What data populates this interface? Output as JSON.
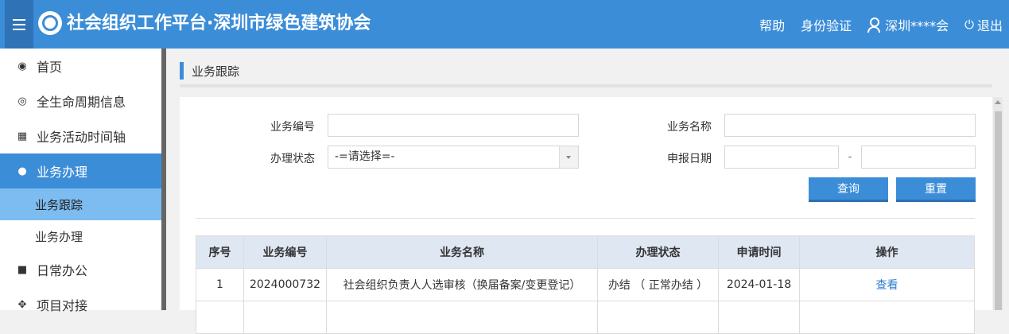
{
  "header": {
    "title": "社会组织工作平台·深圳市绿色建筑协会",
    "links": {
      "help": "帮助",
      "identity": "身份验证",
      "user": "深圳****会",
      "logout": "退出"
    }
  },
  "sidebar": {
    "items": [
      {
        "label": "首页",
        "icon": "dashboard-icon"
      },
      {
        "label": "全生命周期信息",
        "icon": "eye-icon"
      },
      {
        "label": "业务活动时间轴",
        "icon": "calendar-icon"
      },
      {
        "label": "业务办理",
        "icon": "info-icon"
      },
      {
        "label": "业务跟踪",
        "icon": ""
      },
      {
        "label": "业务办理",
        "icon": ""
      },
      {
        "label": "日常办公",
        "icon": "briefcase-icon"
      },
      {
        "label": "项目对接",
        "icon": "handshake-icon"
      }
    ]
  },
  "breadcrumb": {
    "title": "业务跟踪"
  },
  "form": {
    "biz_no_label": "业务编号",
    "biz_no_value": "",
    "biz_name_label": "业务名称",
    "biz_name_value": "",
    "status_label": "办理状态",
    "status_selected": "-=请选择=-",
    "date_label": "申报日期",
    "date_from": "",
    "date_sep": "-",
    "date_to": "",
    "query_button": "查询",
    "reset_button": "重置"
  },
  "table": {
    "headers": [
      "序号",
      "业务编号",
      "业务名称",
      "办理状态",
      "申请时间",
      "操作"
    ],
    "rows": [
      [
        "1",
        "2024000732",
        "社会组织负责人人选审核（换届备案/变更登记）",
        "办结 （ 正常办结 ）",
        "2024-01-18",
        "查看"
      ]
    ]
  },
  "colors": {
    "primary": "#3c8dd8",
    "sidebar_active": "#3c8dd8",
    "sub_active": "#7cbcf0",
    "table_header": "#dfe7f3"
  }
}
